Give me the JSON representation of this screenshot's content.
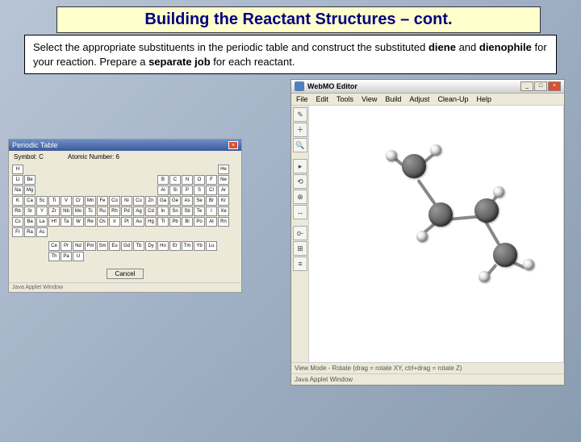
{
  "slide": {
    "title": "Building the Reactant Structures – cont.",
    "instruction_html": "Select the appropriate substituents in the periodic table and construct the substituted <b>diene</b> and <b>dienophile</b> for your reaction. Prepare a <b>separate job</b> for each reactant."
  },
  "periodic_table": {
    "window_title": "Periodic Table",
    "symbol_label": "Symbol:",
    "symbol_value": "C",
    "atomic_label": "Atomic Number:",
    "atomic_value": "6",
    "cancel": "Cancel",
    "footer": "Java Applet Window",
    "rows": [
      [
        "H",
        "",
        "",
        "",
        "",
        "",
        "",
        "",
        "",
        "",
        "",
        "",
        "",
        "",
        "",
        "",
        "",
        "He"
      ],
      [
        "Li",
        "Be",
        "",
        "",
        "",
        "",
        "",
        "",
        "",
        "",
        "",
        "",
        "B",
        "C",
        "N",
        "O",
        "F",
        "Ne"
      ],
      [
        "Na",
        "Mg",
        "",
        "",
        "",
        "",
        "",
        "",
        "",
        "",
        "",
        "",
        "Al",
        "Si",
        "P",
        "S",
        "Cl",
        "Ar"
      ],
      [
        "K",
        "Ca",
        "Sc",
        "Ti",
        "V",
        "Cr",
        "Mn",
        "Fe",
        "Co",
        "Ni",
        "Cu",
        "Zn",
        "Ga",
        "Ge",
        "As",
        "Se",
        "Br",
        "Kr"
      ],
      [
        "Rb",
        "Sr",
        "Y",
        "Zr",
        "Nb",
        "Mo",
        "Tc",
        "Ru",
        "Rh",
        "Pd",
        "Ag",
        "Cd",
        "In",
        "Sn",
        "Sb",
        "Te",
        "I",
        "Xe"
      ],
      [
        "Cs",
        "Ba",
        "La",
        "Hf",
        "Ta",
        "W",
        "Re",
        "Os",
        "Ir",
        "Pt",
        "Au",
        "Hg",
        "Tl",
        "Pb",
        "Bi",
        "Po",
        "At",
        "Rn"
      ],
      [
        "Fr",
        "Ra",
        "Ac",
        "",
        "",
        "",
        "",
        "",
        "",
        "",
        "",
        "",
        "",
        "",
        "",
        "",
        "",
        ""
      ]
    ],
    "lanth": [
      "Ce",
      "Pr",
      "Nd",
      "Pm",
      "Sm",
      "Eu",
      "Gd",
      "Tb",
      "Dy",
      "Ho",
      "Er",
      "Tm",
      "Yb",
      "Lu"
    ],
    "actin": [
      "Th",
      "Pa",
      "U",
      "",
      "",
      "",
      "",
      "",
      "",
      "",
      "",
      "",
      "",
      ""
    ]
  },
  "editor": {
    "window_title": "WebMO Editor",
    "menus": [
      "File",
      "Edit",
      "Tools",
      "View",
      "Build",
      "Adjust",
      "Clean-Up",
      "Help"
    ],
    "tools": [
      "✎",
      "＋",
      "🔍",
      "",
      "▸",
      "⟲",
      "⊕",
      "↔",
      "",
      "o-",
      "⊞",
      "≡"
    ],
    "status": "View Mode - Rotate (drag = rotate XY, ctrl+drag = rotate Z)",
    "footer": "Java Applet Window"
  }
}
